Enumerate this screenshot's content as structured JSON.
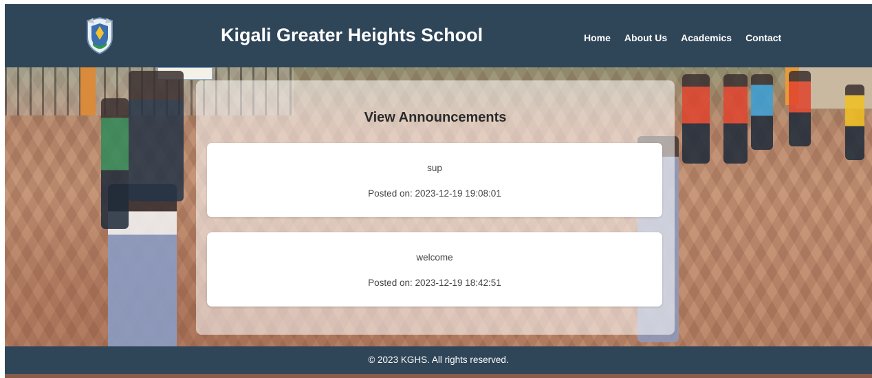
{
  "site": {
    "title": "Kigali Greater Heights School"
  },
  "nav": {
    "items": [
      "Home",
      "About Us",
      "Academics",
      "Contact"
    ]
  },
  "main": {
    "heading": "View Announcements",
    "announcements": [
      {
        "message": "sup",
        "date": "Posted on: 2023-12-19 19:08:01"
      },
      {
        "message": "welcome",
        "date": "Posted on: 2023-12-19 18:42:51"
      }
    ]
  },
  "footer": {
    "copyright": "© 2023 KGHS. All rights reserved."
  },
  "colors": {
    "header_bg": "#2f4558",
    "text_on_header": "#ffffff"
  },
  "icons": {
    "logo": "school-crest-icon"
  }
}
